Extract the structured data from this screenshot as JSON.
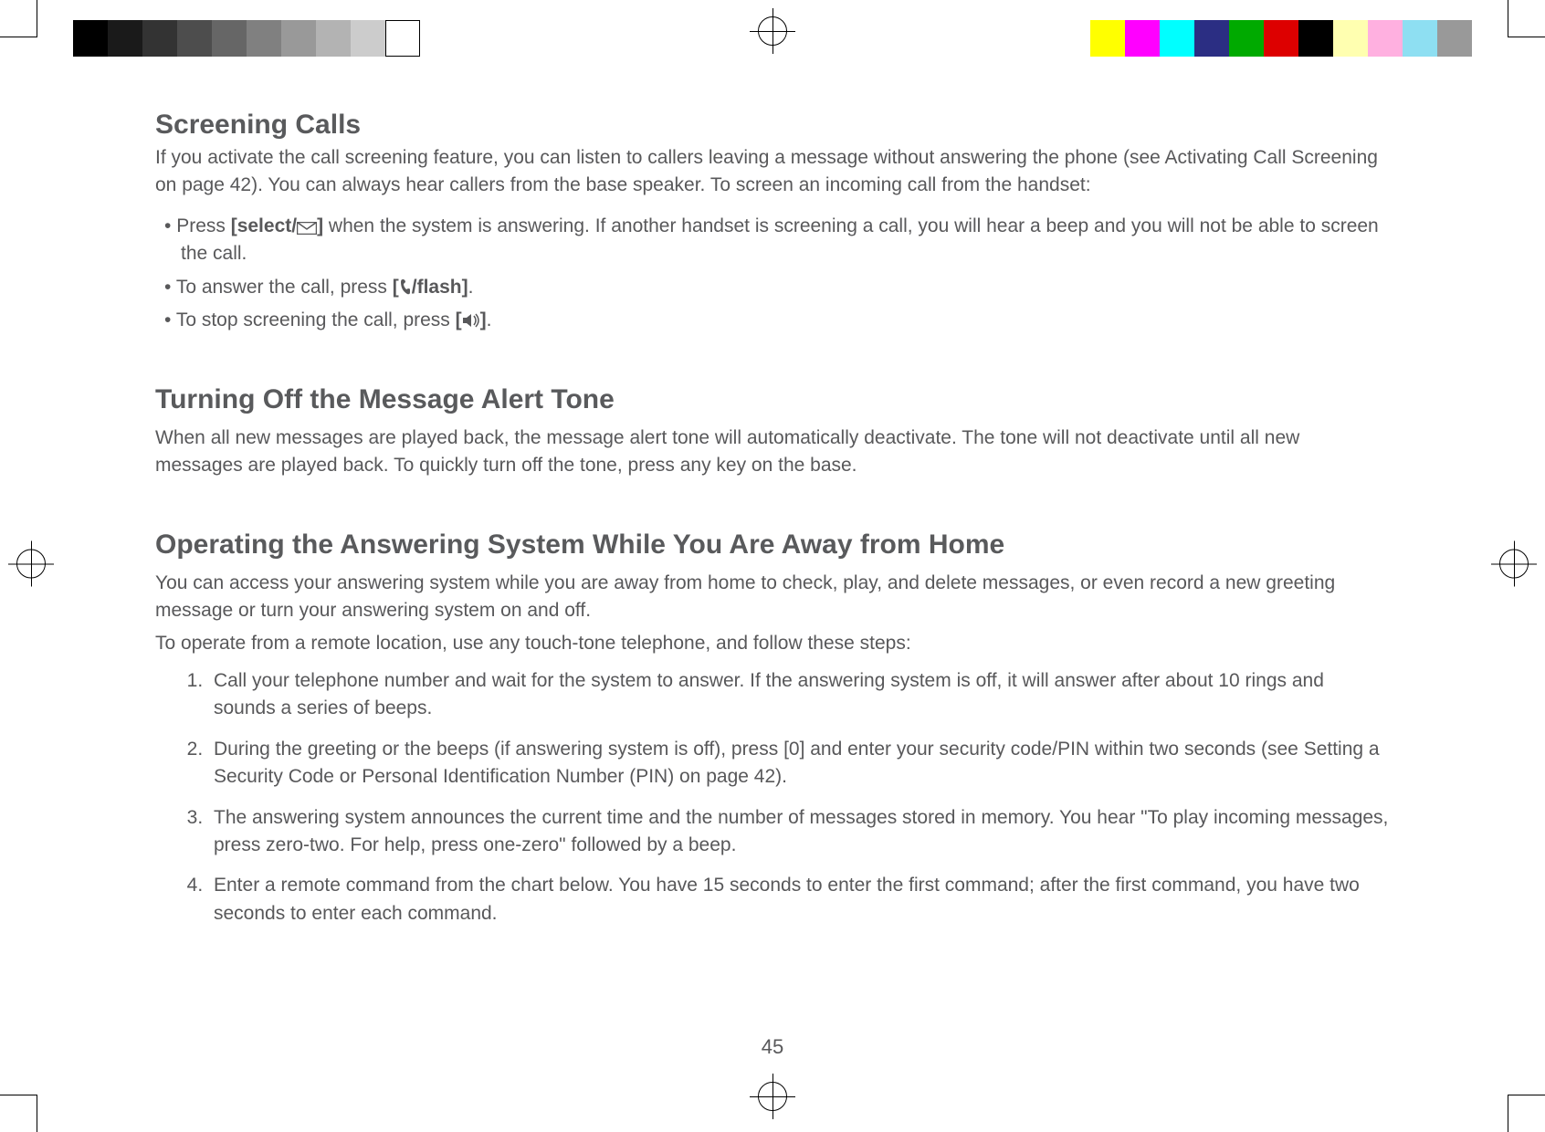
{
  "page_number": "45",
  "section1": {
    "heading": "Screening Calls",
    "intro": "If you activate the call screening feature, you can listen to callers leaving a message without answering the phone (see Activating Call Screening on page 42). You can always hear callers from the base speaker. To screen an incoming call from the handset:",
    "b1_pre": "Press ",
    "b1_btn": "[select/",
    "b1_btn2": "]",
    "b1_rest": " when the system is answering. If another handset is screening a call, you will hear a beep and you will not be able to screen the call.",
    "b2_pre": "To answer the call, press ",
    "b2_btn_a": "[",
    "b2_btn_b": "/flash]",
    "b2_rest": ".",
    "b3_pre": "To stop screening the call, press ",
    "b3_btn_a": "[",
    "b3_btn_b": "]",
    "b3_rest": "."
  },
  "section2": {
    "heading": "Turning Off the Message Alert Tone",
    "body": "When all new messages are played back, the message alert tone will automatically deactivate. The tone will not deactivate until all new messages are played back. To quickly turn off the tone, press any key on the base."
  },
  "section3": {
    "heading": "Operating the Answering System While You Are Away from Home",
    "intro1": "You can access your answering system while you are away from home to check, play, and delete messages, or even record a new greeting message or turn your answering system on and off.",
    "intro2": "To operate from a remote location, use any touch-tone telephone, and follow these steps:",
    "s1": "Call your telephone number and wait for the system to answer. If the answering system is off, it will answer after about 10 rings and sounds a series of beeps.",
    "s2": "During the greeting or the beeps (if answering system is off), press [0] and enter your security code/PIN within two seconds (see Setting a Security Code or Personal Identification Number (PIN) on page 42).",
    "s3": "The answering system announces the current time and the number of messages stored in memory. You hear \"To play incoming messages, press zero-two. For help, press one-zero\" followed by a beep.",
    "s4": "Enter a remote command from the chart below. You have 15 seconds to enter the first command; after the first command, you have two seconds to enter each command."
  }
}
